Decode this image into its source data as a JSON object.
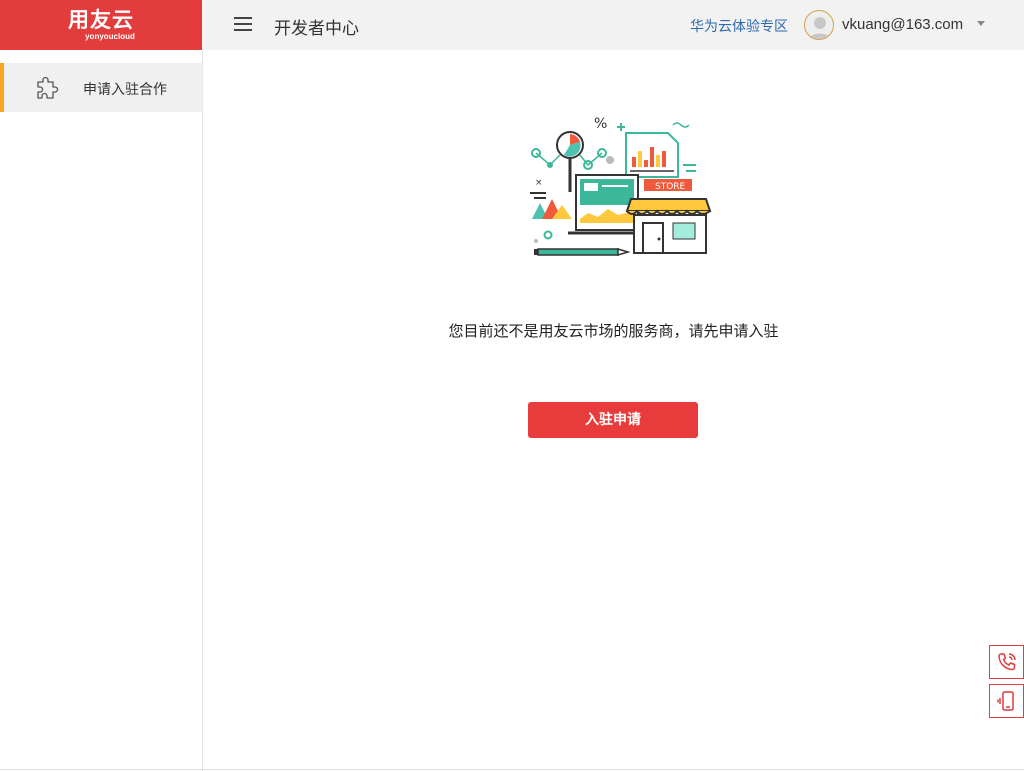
{
  "brand": {
    "name": "用友云",
    "subtitle": "yonyoucloud",
    "color": "#e33c3c"
  },
  "header": {
    "title": "开发者中心",
    "menu_icon": "hamburger-icon",
    "huawei_link": "华为云体验专区",
    "user_email": "vkuang@163.com",
    "link_color": "#2f6aaf"
  },
  "sidebar": {
    "items": [
      {
        "label": "申请入驻合作",
        "icon": "puzzle-icon",
        "active": true
      }
    ],
    "active_color": "#f5a623"
  },
  "main": {
    "illustration": {
      "store_label": "STORE",
      "icon": "store-illustration"
    },
    "message": "您目前还不是用友云市场的服务商，请先申请入驻",
    "apply_button": "入驻申请",
    "button_color": "#e83c3c"
  },
  "floating": {
    "items": [
      {
        "icon": "phone-icon"
      },
      {
        "icon": "mobile-icon"
      }
    ]
  }
}
